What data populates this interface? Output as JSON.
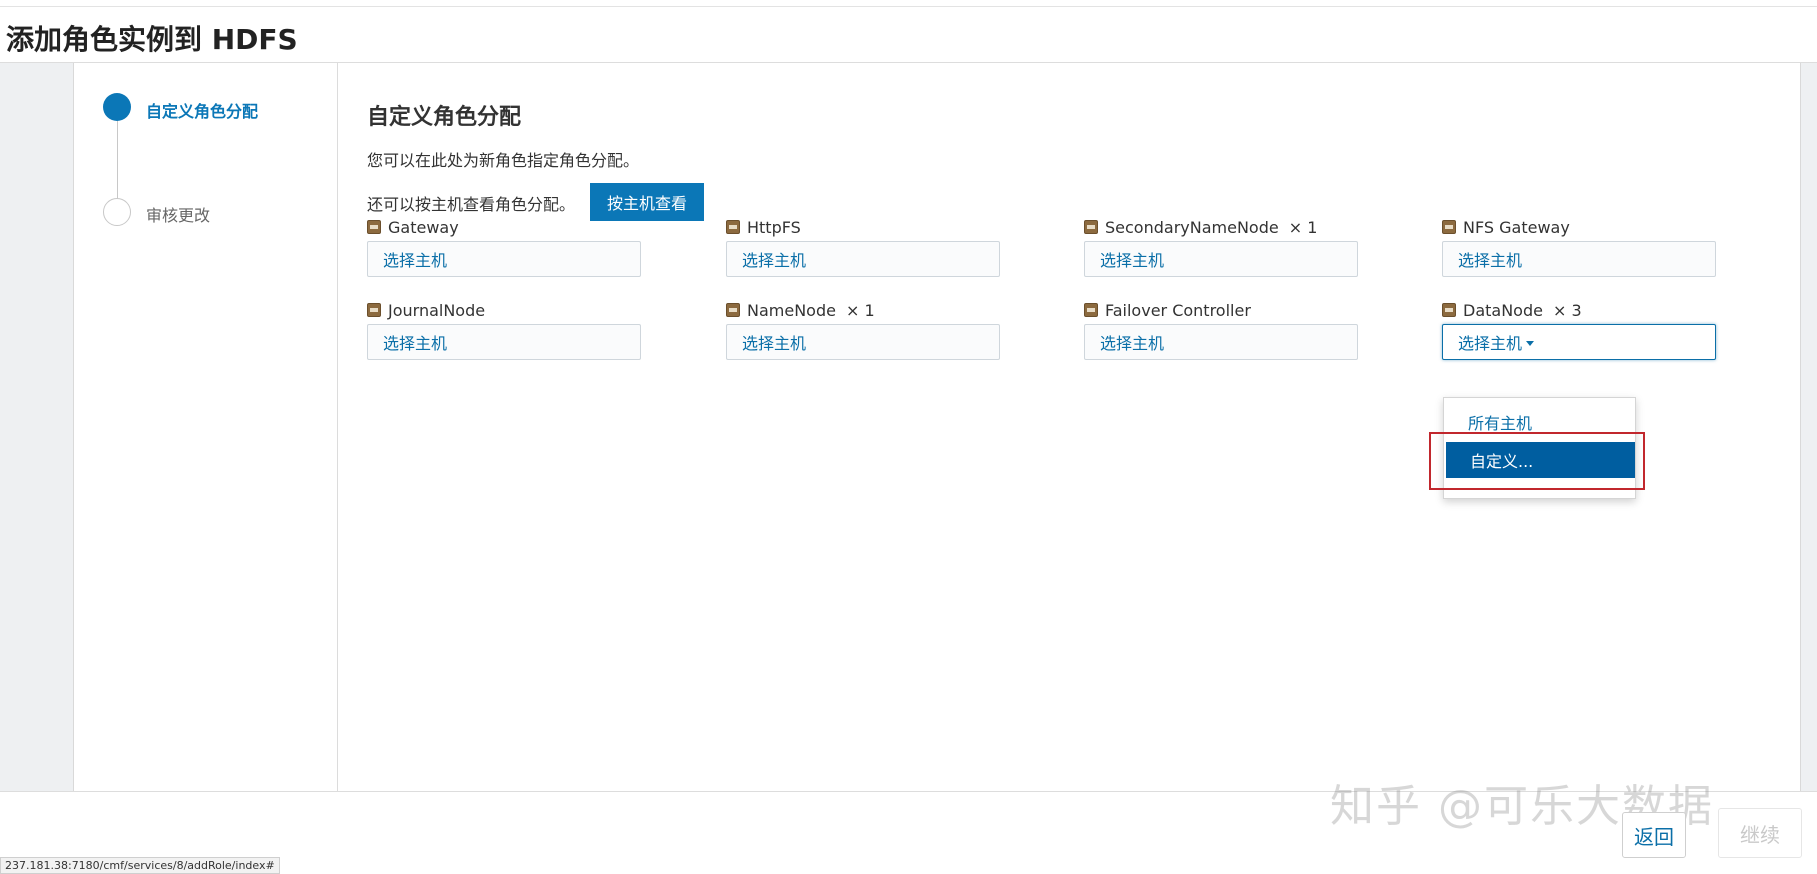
{
  "page": {
    "title": "添加角色实例到 HDFS"
  },
  "wizard": {
    "steps": [
      {
        "label": "自定义角色分配",
        "state": "active"
      },
      {
        "label": "审核更改",
        "state": "pending"
      }
    ]
  },
  "main": {
    "section_title": "自定义角色分配",
    "description": "您可以在此处为新角色指定角色分配。",
    "byhost_text": "还可以按主机查看角色分配。",
    "byhost_button": "按主机查看"
  },
  "roles": [
    {
      "name": "Gateway",
      "count": "",
      "selector": "选择主机"
    },
    {
      "name": "HttpFS",
      "count": "",
      "selector": "选择主机"
    },
    {
      "name": "SecondaryNameNode",
      "count": "× 1",
      "selector": "选择主机"
    },
    {
      "name": "NFS Gateway",
      "count": "",
      "selector": "选择主机"
    },
    {
      "name": "JournalNode",
      "count": "",
      "selector": "选择主机"
    },
    {
      "name": "NameNode",
      "count": "× 1",
      "selector": "选择主机"
    },
    {
      "name": "Failover Controller",
      "count": "",
      "selector": "选择主机"
    },
    {
      "name": "DataNode",
      "count": "× 3",
      "selector": "选择主机",
      "open": true
    }
  ],
  "dropdown": {
    "options": [
      "所有主机",
      "自定义..."
    ],
    "highlighted": "自定义..."
  },
  "footer": {
    "back_button": "返回",
    "continue_button": "继续",
    "status_url": "237.181.38:7180/cmf/services/8/addRole/index#"
  },
  "watermark": "知乎 @可乐大数据",
  "colors": {
    "accent": "#0b77b7",
    "link": "#0b6fa8",
    "highlight_box": "#c1272d",
    "menu_selected": "#005ea0"
  },
  "icons": {
    "role_icon": "role-icon"
  }
}
